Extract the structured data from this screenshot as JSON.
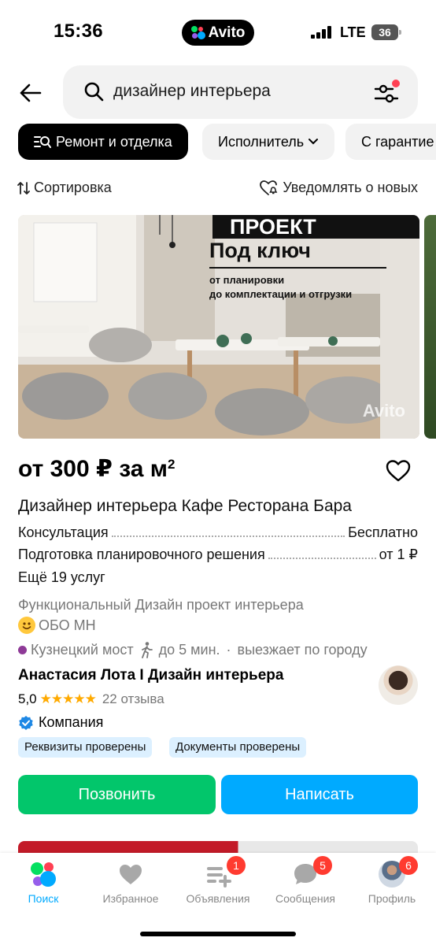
{
  "status_bar": {
    "time": "15:36",
    "island_label": "Avito",
    "network": "LTE",
    "battery": "36"
  },
  "search": {
    "query": "дизайнер интерьера"
  },
  "chips": [
    {
      "label": "Ремонт и отделка"
    },
    {
      "label": "Исполнитель"
    },
    {
      "label": "С гарантие"
    }
  ],
  "sort_label": "Сортировка",
  "notify_label": "Уведомлять о новых",
  "photo": {
    "promo_title_line1": "ПРОЕКТ",
    "promo_title_line2": "Под ключ",
    "promo_sub_line1": "от планировки",
    "promo_sub_line2": "до комплектации и отгрузки",
    "watermark": "Avito"
  },
  "listing": {
    "price": "от 300 ₽ за м",
    "price_sup": "2",
    "title": "Дизайнер интерьера Кафе Ресторана Бара",
    "services": [
      {
        "name": "Консультация",
        "value": "Бесплатно"
      },
      {
        "name": "Подготовка планировочного решения",
        "value": "от 1 ₽"
      }
    ],
    "more_services": "Ещё 19 услуг",
    "description": "Функциональный Дизайн проект интерьера",
    "obo": "ОБО МН",
    "metro": "Кузнецкий мост",
    "walk": "до 5 мин.",
    "separator": "·",
    "travel": "выезжает по городу",
    "metro_color": "#8e3a97"
  },
  "seller": {
    "name": "Анастасия Лота I Дизайн интерьера",
    "rating": "5,0",
    "stars": "★★★★★",
    "reviews": "22 отзыва",
    "type": "Компания",
    "badges": [
      "Реквизиты проверены",
      "Документы проверены"
    ]
  },
  "actions": {
    "call": "Позвонить",
    "write": "Написать",
    "call_color": "#02c66b",
    "write_color": "#00aaff"
  },
  "tabbar": [
    {
      "label": "Поиск",
      "icon": "avito-search-icon",
      "active": true
    },
    {
      "label": "Избранное",
      "icon": "heart-icon"
    },
    {
      "label": "Объявления",
      "icon": "ads-icon",
      "badge": "1"
    },
    {
      "label": "Сообщения",
      "icon": "chat-icon",
      "badge": "5"
    },
    {
      "label": "Профиль",
      "icon": "profile-avatar-icon",
      "badge": "6"
    }
  ]
}
